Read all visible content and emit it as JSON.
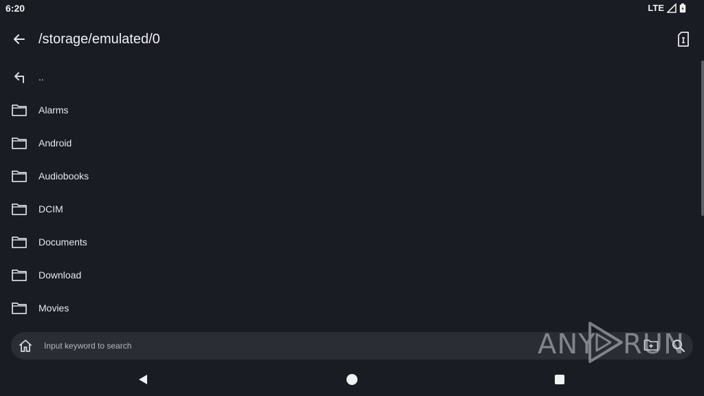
{
  "status_bar": {
    "time": "6:20",
    "network": "LTE"
  },
  "app_bar": {
    "title": "/storage/emulated/0"
  },
  "file_list": {
    "items": [
      {
        "label": "..",
        "icon": "parent-folder-icon"
      },
      {
        "label": "Alarms",
        "icon": "folder-icon"
      },
      {
        "label": "Android",
        "icon": "folder-icon"
      },
      {
        "label": "Audiobooks",
        "icon": "folder-icon"
      },
      {
        "label": "DCIM",
        "icon": "folder-icon"
      },
      {
        "label": "Documents",
        "icon": "folder-icon"
      },
      {
        "label": "Download",
        "icon": "folder-icon"
      },
      {
        "label": "Movies",
        "icon": "folder-icon"
      }
    ]
  },
  "search": {
    "placeholder": "Input keyword to search",
    "value": ""
  },
  "watermark": {
    "left": "ANY",
    "right": "RUN"
  },
  "colors": {
    "background": "#1a1c23",
    "search_background": "#2b2d35",
    "text": "#e8e8ec",
    "icon": "#d8d8dc"
  }
}
